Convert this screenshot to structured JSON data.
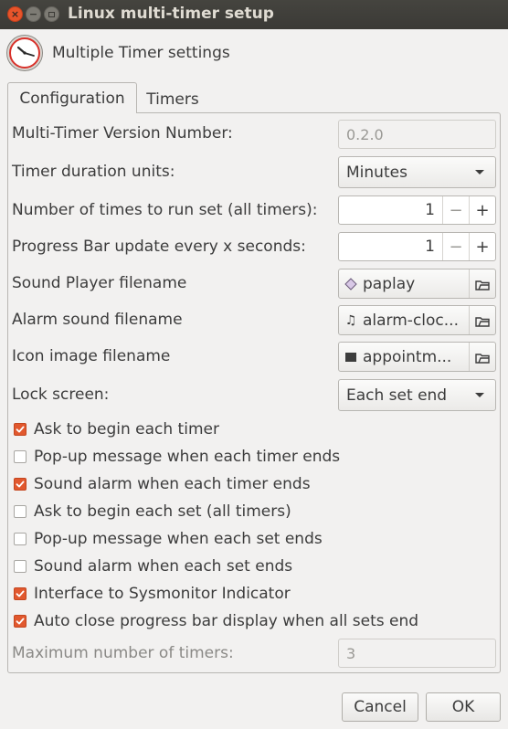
{
  "window": {
    "title": "Linux multi-timer setup"
  },
  "header": {
    "title": "Multiple Timer settings"
  },
  "tabs": [
    {
      "label": "Configuration",
      "active": true
    },
    {
      "label": "Timers",
      "active": false
    }
  ],
  "config": {
    "version": {
      "label": "Multi-Timer Version Number:",
      "value": "0.2.0"
    },
    "duration_units": {
      "label": "Timer duration units:",
      "value": "Minutes"
    },
    "times_to_run": {
      "label": "Number of times to run set (all timers):",
      "value": "1"
    },
    "progress_update": {
      "label": "Progress Bar update every x seconds:",
      "value": "1"
    },
    "sound_player": {
      "label": "Sound Player filename",
      "value": "paplay"
    },
    "alarm_sound": {
      "label": "Alarm sound filename",
      "value": "alarm-cloc..."
    },
    "icon_image": {
      "label": "Icon image filename",
      "value": "appointm..."
    },
    "lock_screen": {
      "label": "Lock screen:",
      "value": "Each set end"
    },
    "checkboxes": [
      {
        "label": "Ask to begin each timer",
        "checked": true
      },
      {
        "label": "Pop-up message when each timer ends",
        "checked": false
      },
      {
        "label": "Sound alarm when each timer ends",
        "checked": true
      },
      {
        "label": "Ask to begin each set (all timers)",
        "checked": false
      },
      {
        "label": "Pop-up message when each set ends",
        "checked": false
      },
      {
        "label": "Sound alarm when each set ends",
        "checked": false
      },
      {
        "label": "Interface to Sysmonitor Indicator",
        "checked": true
      },
      {
        "label": "Auto close progress bar display when all sets end",
        "checked": true
      }
    ],
    "max_timers": {
      "label": "Maximum number of timers:",
      "value": "3"
    }
  },
  "spin": {
    "minus": "−",
    "plus": "+"
  },
  "buttons": {
    "cancel": "Cancel",
    "ok": "OK"
  },
  "colors": {
    "accent": "#e1582e",
    "titlebar": "#3b3a36",
    "background": "#f2f1f0"
  }
}
